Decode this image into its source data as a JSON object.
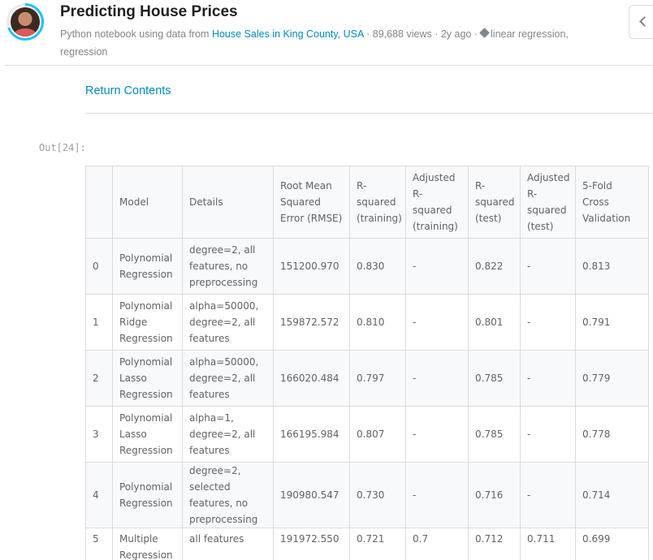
{
  "header": {
    "title": "Predicting House Prices",
    "subtitle_prefix": "Python notebook using data from",
    "dataset_link": "House Sales in King County, USA",
    "views": "· 89,688 views ·",
    "age": "2y ago ·",
    "tags": "linear regression,",
    "tags_line2": "regression",
    "accent_color": "#20beff",
    "link_color": "#008abc",
    "tag_icon": "tag-icon",
    "corner_icon": "chevron-up-icon"
  },
  "nav": {
    "return_label": "Return Contents"
  },
  "cell": {
    "out_label": "Out[24]:"
  },
  "table": {
    "headers": [
      "",
      "Model",
      "Details",
      "Root Mean Squared Error (RMSE)",
      "R-squared (training)",
      "Adjusted R-squared (training)",
      "R-squared (test)",
      "Adjusted R-squared (test)",
      "5-Fold Cross Validation"
    ],
    "rows": [
      [
        "0",
        "Polynomial Regression",
        "degree=2, all features, no preprocessing",
        "151200.970",
        "0.830",
        "-",
        "0.822",
        "-",
        "0.813"
      ],
      [
        "1",
        "Polynomial Ridge Regression",
        "alpha=50000, degree=2, all features",
        "159872.572",
        "0.810",
        "-",
        "0.801",
        "-",
        "0.791"
      ],
      [
        "2",
        "Polynomial Lasso Regression",
        "alpha=50000, degree=2, all features",
        "166020.484",
        "0.797",
        "-",
        "0.785",
        "-",
        "0.779"
      ],
      [
        "3",
        "Polynomial Lasso Regression",
        "alpha=1, degree=2, all features",
        "166195.984",
        "0.807",
        "-",
        "0.785",
        "-",
        "0.778"
      ],
      [
        "4",
        "Polynomial Regression",
        "degree=2, selected features, no preprocessing",
        "190980.547",
        "0.730",
        "-",
        "0.716",
        "-",
        "0.714"
      ],
      [
        "5",
        "Multiple Regression",
        "all features",
        "191972.550",
        "0.721",
        "0.7",
        "0.712",
        "0.711",
        "0.699"
      ]
    ]
  }
}
